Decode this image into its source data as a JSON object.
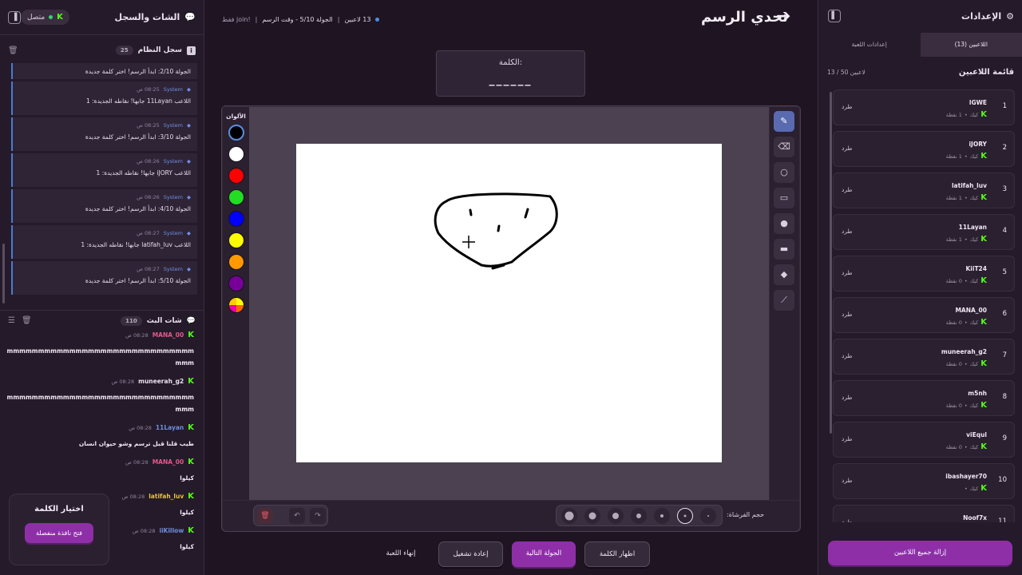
{
  "left_panel": {
    "title": "الشات والسجل",
    "status": "متصل",
    "log": {
      "title": "سجل النظام",
      "count": "25",
      "items": [
        {
          "meta": "",
          "time": "",
          "text": "الجولة 2/10: ابدأ الرسم! اختر كلمة جديدة"
        },
        {
          "meta": "System",
          "time": "08:25 ص",
          "text": "اللاعب 11Layan جابها! نقاطه الجديدة: 1"
        },
        {
          "meta": "System",
          "time": "08:25 ص",
          "text": "الجولة 3/10: ابدأ الرسم! اختر كلمة جديدة"
        },
        {
          "meta": "System",
          "time": "08:26 ص",
          "text": "اللاعب iJORY جابها! نقاطه الجديدة: 1"
        },
        {
          "meta": "System",
          "time": "08:26 ص",
          "text": "الجولة 4/10: ابدأ الرسم! اختر كلمة جديدة"
        },
        {
          "meta": "System",
          "time": "08:27 ص",
          "text": "اللاعب latifah_luv جابها! نقاطه الجديدة: 1"
        },
        {
          "meta": "System",
          "time": "08:27 ص",
          "text": "الجولة 5/10: ابدأ الرسم! اختر كلمة جديدة"
        }
      ]
    },
    "chat": {
      "title": "شات البث",
      "count": "110",
      "messages": [
        {
          "user": "MANA_00",
          "color": "#e25a8c",
          "time": "08:28 ص",
          "text": "mmmmmmmmmmmmmmmmmmmmmmmmmmmmmmmmm"
        },
        {
          "user": "muneerah_g2",
          "color": "#e9e2ee",
          "time": "08:28 ص",
          "text": "mmmmmmmmmmmmmmmmmmmmmmmmmmmmmmmmm"
        },
        {
          "user": "11Layan",
          "color": "#6d8fe0",
          "time": "08:28 ص",
          "text": "طيب قلنا قبل ترسم وشو حيوان انسان"
        },
        {
          "user": "MANA_00",
          "color": "#e25a8c",
          "time": "08:28 ص",
          "text": "كيلوا"
        },
        {
          "user": "latifah_luv",
          "color": "#e8c33c",
          "time": "08:28 ص",
          "text": "كيلوا"
        },
        {
          "user": "iiKillow",
          "color": "#6d8fe0",
          "time": "08:28 ص",
          "text": "كيلوا"
        }
      ]
    },
    "word_card": {
      "title": "اختيار الكلمة",
      "button": "فتح نافذة منفصلة"
    }
  },
  "center": {
    "title": "تحدي الرسم",
    "top_info": {
      "players": "13 لاعبين",
      "round": "الجولة 5/10 - وقت الرسم",
      "join": "!join فقط"
    },
    "word_label": "الكلمة:",
    "word_blanks": "______",
    "colors_label": "الألوان",
    "colors": [
      "#000000",
      "#ffffff",
      "#ff0000",
      "#22dd22",
      "#0000ff",
      "#ffff00",
      "#ff9900",
      "#770099"
    ],
    "brush_label": "حجم الفرشاة:",
    "actions": {
      "reveal": "اظهار الكلمة",
      "next": "الجولة التالية",
      "restart": "إعادة تشغيل",
      "end": "إنهاء اللعبة"
    }
  },
  "right_panel": {
    "title": "الإعدادات",
    "tabs": {
      "players": "اللاعبين (13)",
      "settings": "إعدادات اللعبة"
    },
    "list_title": "قائمة اللاعبين",
    "list_count": "13 / 50 لاعبين",
    "kick_label": "طرد",
    "platform": "كيك",
    "players": [
      {
        "num": "1",
        "name": "lGWE",
        "points": "1 نقطة"
      },
      {
        "num": "2",
        "name": "iJORY",
        "points": "1 نقطة"
      },
      {
        "num": "3",
        "name": "latifah_luv",
        "points": "1 نقطة"
      },
      {
        "num": "4",
        "name": "11Layan",
        "points": "1 نقطة"
      },
      {
        "num": "5",
        "name": "KiiT24",
        "points": "0 نقطة"
      },
      {
        "num": "6",
        "name": "MANA_00",
        "points": "0 نقطة"
      },
      {
        "num": "7",
        "name": "muneerah_g2",
        "points": "0 نقطة"
      },
      {
        "num": "8",
        "name": "m5nh",
        "points": "0 نقطة"
      },
      {
        "num": "9",
        "name": "viEqul",
        "points": "0 نقطة"
      },
      {
        "num": "10",
        "name": "ibashayer70",
        "points": ""
      },
      {
        "num": "11",
        "name": "Noof7x",
        "points": ""
      }
    ],
    "remove_all": "إزالة جميع اللاعبين"
  }
}
